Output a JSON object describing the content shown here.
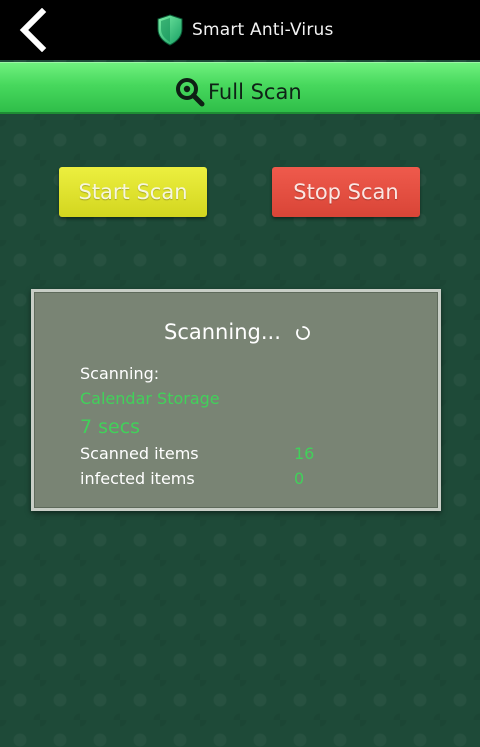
{
  "topbar": {
    "back_icon": "chevron-left-icon",
    "app_icon": "shield-icon",
    "title": "Smart Anti-Virus"
  },
  "scanbar": {
    "icon": "magnifier-icon",
    "title": "Full Scan"
  },
  "buttons": {
    "start": "Start Scan",
    "stop": "Stop Scan"
  },
  "panel": {
    "title": "Scanning...",
    "spinner_icon": "spinner-icon",
    "scanning_label": "Scanning:",
    "target": "Calendar Storage",
    "elapsed": "7 secs",
    "scanned_label": "Scanned items",
    "scanned_value": "16",
    "infected_label": "infected items",
    "infected_value": "0"
  },
  "colors": {
    "background": "#1e4a38",
    "accent_green": "#41d15a",
    "start_button": "#e2e52f",
    "stop_button": "#e5503f",
    "panel": "#798474"
  }
}
